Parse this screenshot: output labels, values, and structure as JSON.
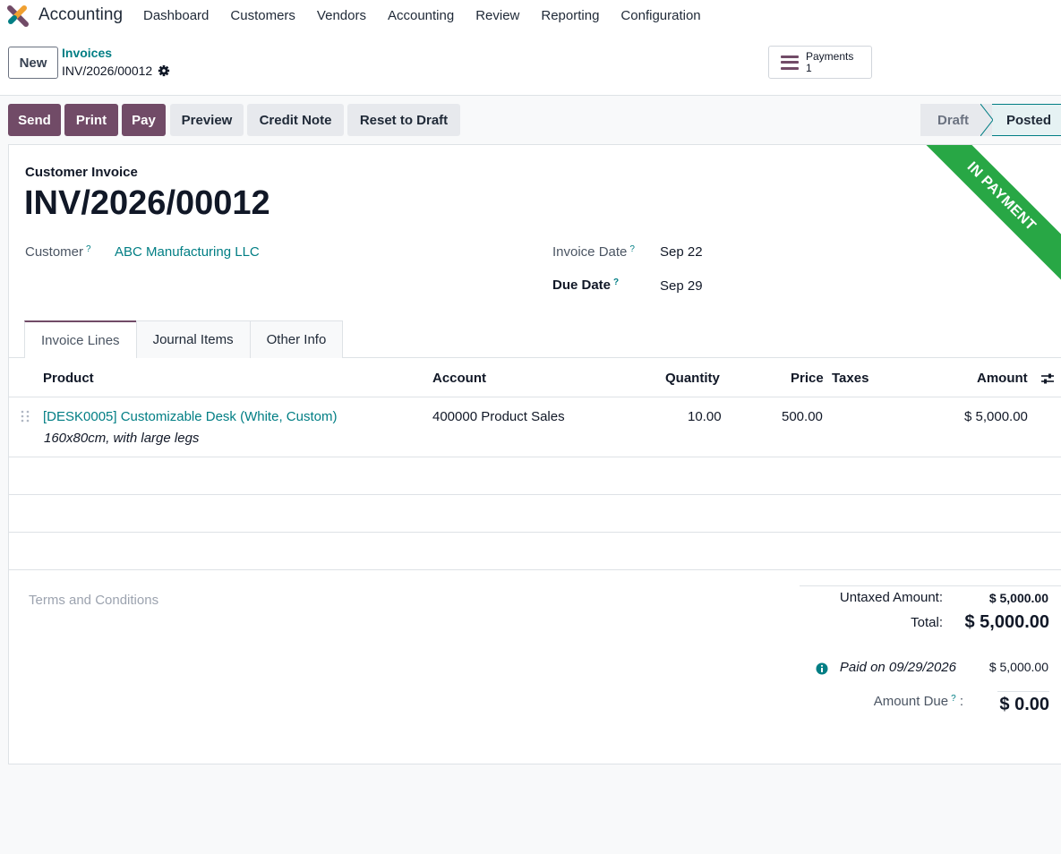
{
  "app": {
    "name": "Accounting"
  },
  "menu": [
    "Dashboard",
    "Customers",
    "Vendors",
    "Accounting",
    "Review",
    "Reporting",
    "Configuration"
  ],
  "control": {
    "new_label": "New",
    "breadcrumb_parent": "Invoices",
    "breadcrumb_current": "INV/2026/00012",
    "smart_button": {
      "label": "Payments",
      "count": "1"
    }
  },
  "actions": {
    "send": "Send",
    "print": "Print",
    "pay": "Pay",
    "preview": "Preview",
    "credit_note": "Credit Note",
    "reset": "Reset to Draft"
  },
  "status": {
    "draft": "Draft",
    "posted": "Posted",
    "current": "Posted"
  },
  "ribbon": "IN PAYMENT",
  "form": {
    "doc_type": "Customer Invoice",
    "name": "INV/2026/00012",
    "customer_label": "Customer",
    "customer_value": "ABC Manufacturing LLC",
    "invoice_date_label": "Invoice Date",
    "invoice_date_value": "Sep 22",
    "due_date_label": "Due Date",
    "due_date_value": "Sep 29",
    "help_mark": "?"
  },
  "tabs": [
    "Invoice Lines",
    "Journal Items",
    "Other Info"
  ],
  "table": {
    "headers": {
      "product": "Product",
      "account": "Account",
      "quantity": "Quantity",
      "price": "Price",
      "taxes": "Taxes",
      "amount": "Amount"
    },
    "rows": [
      {
        "product": "[DESK0005] Customizable Desk (White, Custom)",
        "description": "160x80cm, with large legs",
        "account": "400000 Product Sales",
        "quantity": "10.00",
        "price": "500.00",
        "taxes": "",
        "amount": "$ 5,000.00"
      }
    ]
  },
  "footer": {
    "terms_placeholder": "Terms and Conditions",
    "untaxed_label": "Untaxed Amount:",
    "untaxed_value": "$ 5,000.00",
    "total_label": "Total:",
    "total_value": "$ 5,000.00",
    "payment_label": "Paid on 09/29/2026",
    "payment_value": "$ 5,000.00",
    "due_label": "Amount Due",
    "due_value": "$ 0.00"
  },
  "colors": {
    "brand": "#714B67",
    "link": "#017e84",
    "ribbon": "#28a745"
  }
}
